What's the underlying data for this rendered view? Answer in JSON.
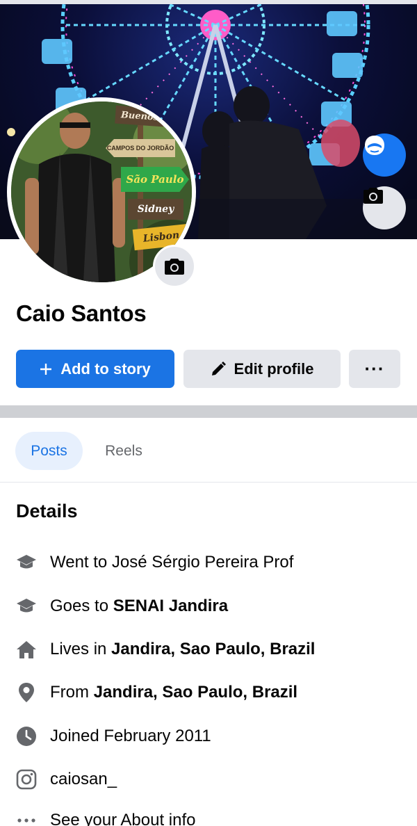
{
  "profile": {
    "name": "Caio Santos"
  },
  "cover": {
    "sign_labels": [
      "Buenos",
      "CAMPOS DO JORDÃO",
      "São Paulo",
      "Sidney",
      "Lisbon"
    ]
  },
  "actions": {
    "add_story_label": "Add to story",
    "edit_profile_label": "Edit profile",
    "more_label": "···"
  },
  "tabs": [
    {
      "label": "Posts",
      "active": true
    },
    {
      "label": "Reels",
      "active": false
    }
  ],
  "details": {
    "title": "Details",
    "items": [
      {
        "icon": "graduation-cap-icon",
        "prefix": "Went to José Sérgio Pereira Prof",
        "bold": ""
      },
      {
        "icon": "graduation-cap-icon",
        "prefix": "Goes to ",
        "bold": "SENAI Jandira"
      },
      {
        "icon": "home-icon",
        "prefix": "Lives in ",
        "bold": "Jandira, Sao Paulo, Brazil"
      },
      {
        "icon": "location-pin-icon",
        "prefix": "From ",
        "bold": "Jandira, Sao Paulo, Brazil"
      },
      {
        "icon": "clock-icon",
        "prefix": "Joined February 2011",
        "bold": ""
      },
      {
        "icon": "instagram-icon",
        "prefix": "caiosan_",
        "bold": ""
      },
      {
        "icon": "more-dots-icon",
        "prefix": "See your About info",
        "bold": ""
      }
    ]
  },
  "colors": {
    "primary": "#1b74e4",
    "button_gray": "#e4e6eb",
    "tab_active_bg": "#e7f0fd",
    "text_secondary": "#65676b",
    "icon_gray": "#65676b"
  }
}
